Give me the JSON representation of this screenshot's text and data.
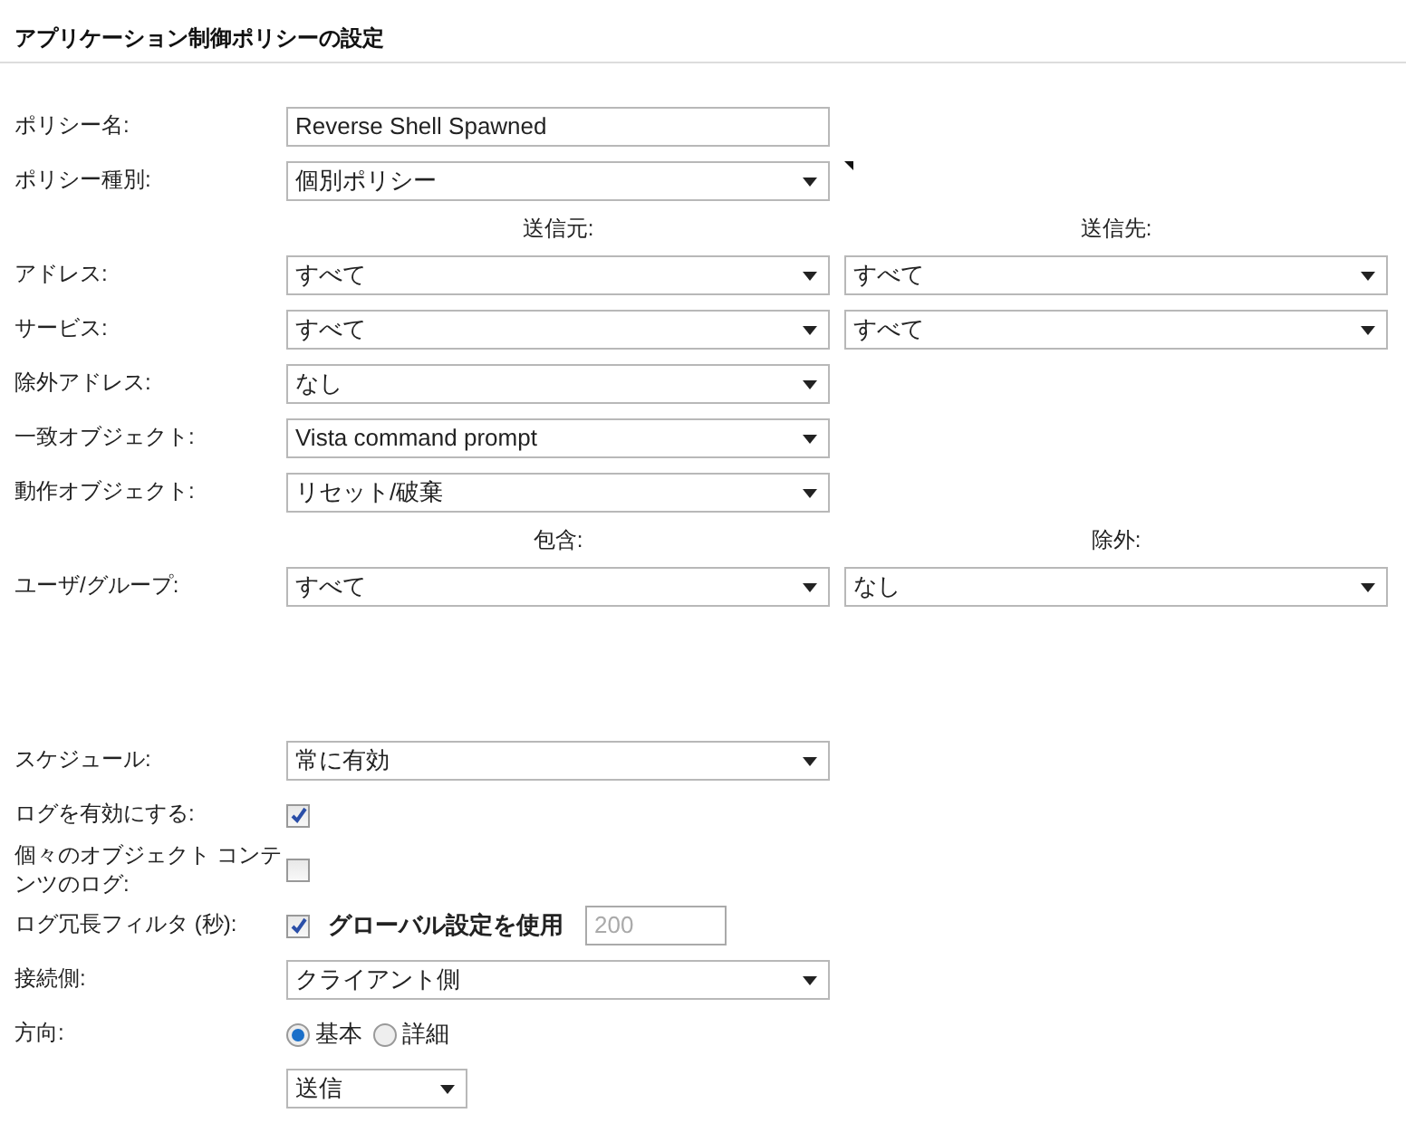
{
  "title": "アプリケーション制御ポリシーの設定",
  "sections": [
    {
      "rows": [
        {
          "kind": "text",
          "label": "ポリシー名:",
          "value": "Reverse Shell Spawned"
        },
        {
          "kind": "select",
          "label": "ポリシー種別:",
          "value": "個別ポリシー",
          "marker": true
        },
        {
          "kind": "headings",
          "headings": [
            "送信元:",
            "送信先:"
          ]
        },
        {
          "kind": "select-pair",
          "label": "アドレス:",
          "values": [
            "すべて",
            "すべて"
          ]
        },
        {
          "kind": "select-pair",
          "label": "サービス:",
          "values": [
            "すべて",
            "すべて"
          ]
        },
        {
          "kind": "select",
          "label": "除外アドレス:",
          "value": "なし"
        },
        {
          "kind": "select",
          "label": "一致オブジェクト:",
          "value": "Vista command prompt"
        },
        {
          "kind": "select",
          "label": "動作オブジェクト:",
          "value": "リセット/破棄"
        },
        {
          "kind": "headings",
          "headings": [
            "包含:",
            "除外:"
          ]
        },
        {
          "kind": "select-pair",
          "label": "ユーザ/グループ:",
          "values": [
            "すべて",
            "なし"
          ]
        }
      ]
    },
    {
      "rows": [
        {
          "kind": "select",
          "label": "スケジュール:",
          "value": "常に有効"
        },
        {
          "kind": "checkbox",
          "label": "ログを有効にする:",
          "checked": true
        },
        {
          "kind": "checkbox",
          "label": "個々のオブジェクト コンテンツのログ:",
          "checked": false
        },
        {
          "kind": "checkbox-field",
          "label": "ログ冗長フィルタ (秒):",
          "checked": true,
          "option": "グローバル設定を使用",
          "value": "200",
          "disabled": true
        },
        {
          "kind": "select",
          "label": "接続側:",
          "value": "クライアント側"
        },
        {
          "kind": "radio",
          "label": "方向:",
          "options": [
            {
              "label": "基本",
              "selected": true
            },
            {
              "label": "詳細",
              "selected": false
            }
          ]
        },
        {
          "kind": "select-small",
          "value": "送信"
        }
      ]
    }
  ]
}
